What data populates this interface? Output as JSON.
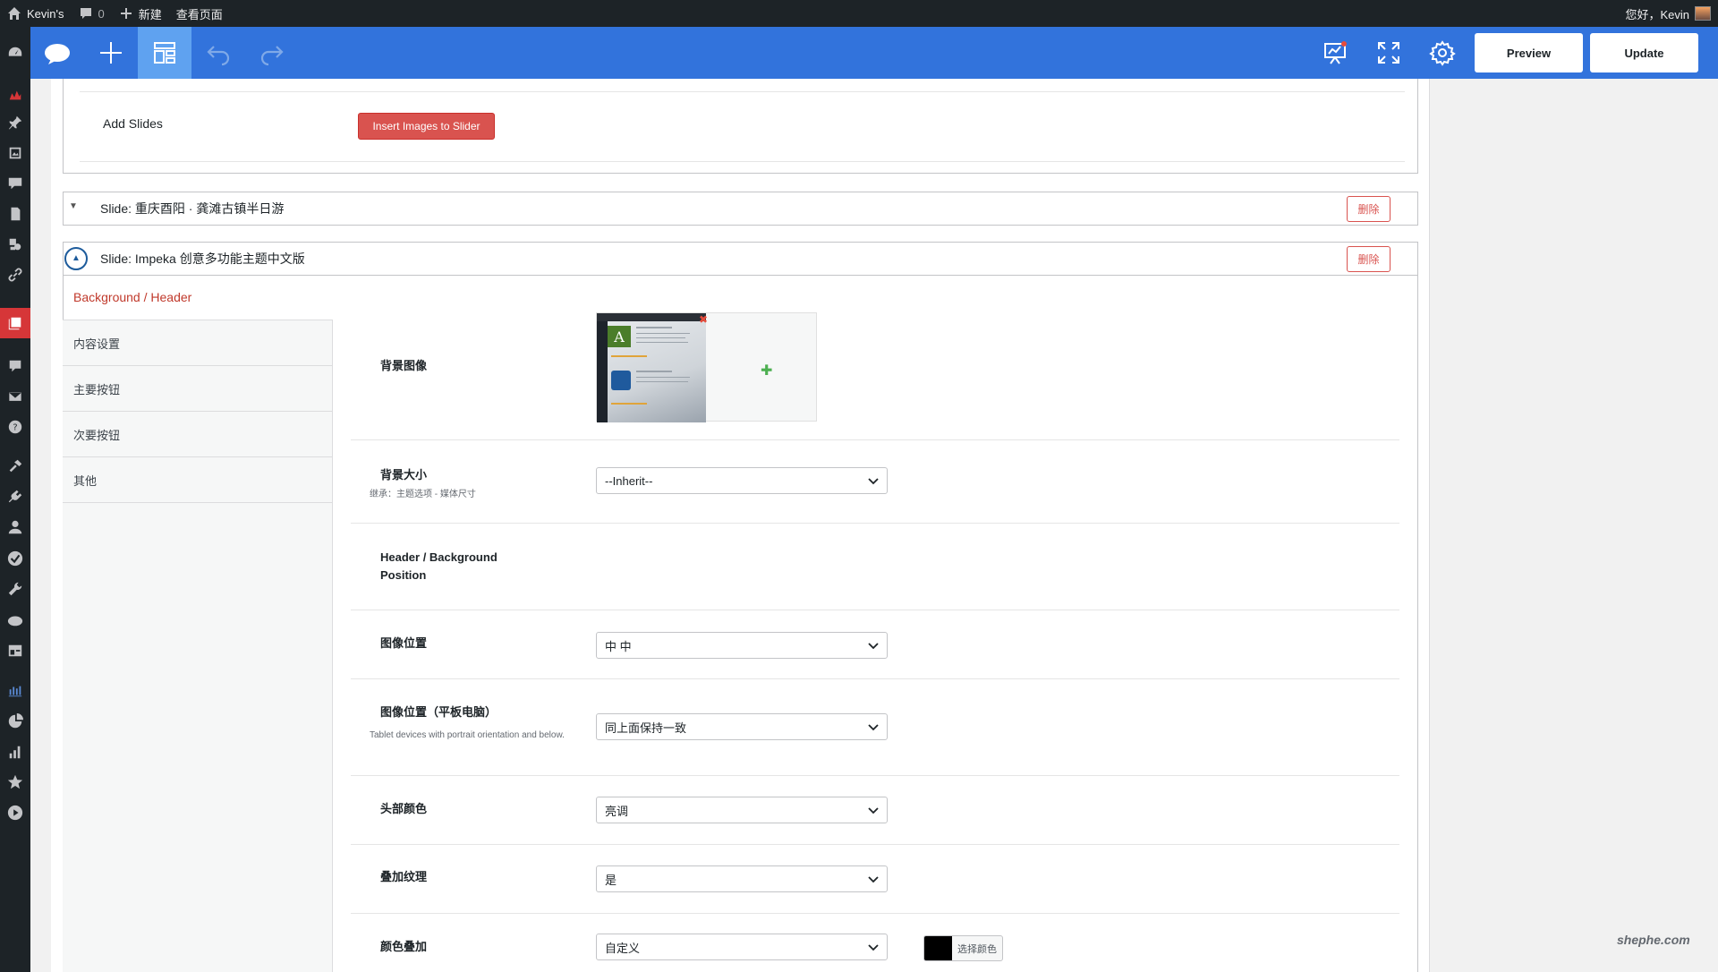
{
  "adminbar": {
    "site_name": "Kevin's",
    "comments_count": "0",
    "new_label": "新建",
    "view_page_label": "查看页面",
    "greeting": "您好，Kevin"
  },
  "toolbar": {
    "preview_label": "Preview",
    "update_label": "Update"
  },
  "slider": {
    "add_slides_label": "Add Slides",
    "insert_button_label": "Insert Images to Slider"
  },
  "slides": [
    {
      "title": "Slide: 重庆酉阳 · 龚滩古镇半日游",
      "delete_label": "删除",
      "expanded": false
    },
    {
      "title": "Slide: Impeka 创意多功能主题中文版",
      "delete_label": "删除",
      "expanded": true
    }
  ],
  "section_link": "Background / Header",
  "subnav": [
    {
      "label": "内容设置"
    },
    {
      "label": "主要按钮"
    },
    {
      "label": "次要按钮"
    },
    {
      "label": "其他"
    }
  ],
  "fields": {
    "bg_image": {
      "label": "背景图像"
    },
    "bg_size": {
      "label": "背景大小",
      "desc": "继承：主题选项 - 媒体尺寸",
      "value": "--Inherit--"
    },
    "header_bg_position": {
      "label": "Header / Background Position"
    },
    "image_position": {
      "label": "图像位置",
      "value": "中 中"
    },
    "image_position_tablet": {
      "label": "图像位置（平板电脑）",
      "desc": "Tablet devices with portrait orientation and below.",
      "value": "同上面保持一致"
    },
    "header_color": {
      "label": "头部颜色",
      "value": "亮调"
    },
    "overlay_pattern": {
      "label": "叠加纹理",
      "value": "是"
    },
    "color_overlay": {
      "label": "颜色叠加",
      "value": "自定义",
      "color_button_label": "选择颜色",
      "swatch_color": "#000000"
    }
  },
  "thumbnail": {
    "letter": "A"
  },
  "watermark": "shephe.com",
  "colors": {
    "toolbar": "#3273dc",
    "accent_red": "#d9534f",
    "adminbar": "#1d2327"
  }
}
